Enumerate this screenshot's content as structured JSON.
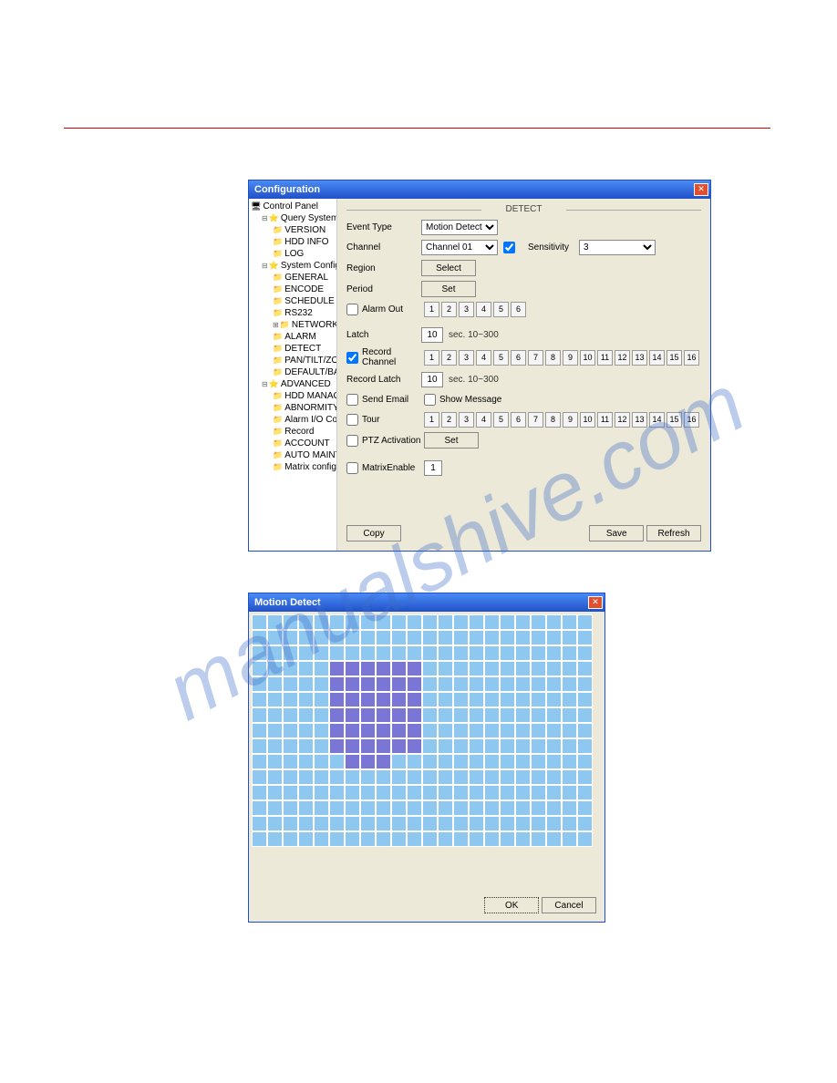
{
  "win1": {
    "title": "Configuration",
    "tree": {
      "root": "Control Panel",
      "groups": [
        {
          "label": "Query System Info",
          "children": [
            "VERSION",
            "HDD INFO",
            "LOG"
          ]
        },
        {
          "label": "System Config",
          "children": [
            "GENERAL",
            "ENCODE",
            "SCHEDULE",
            "RS232",
            "NETWORK",
            "ALARM",
            "DETECT",
            "PAN/TILT/ZOOM",
            "DEFAULT/BACKUP"
          ],
          "selected": "DETECT",
          "expandable": "NETWORK"
        },
        {
          "label": "ADVANCED",
          "children": [
            "HDD MANAGEMENT",
            "ABNORMITY",
            "Alarm I/O Config",
            "Record",
            "ACCOUNT",
            "AUTO MAINTENANCE",
            "Matrix config"
          ]
        }
      ]
    },
    "section": "DETECT",
    "labels": {
      "eventType": "Event Type",
      "channel": "Channel",
      "sensitivity": "Sensitivity",
      "region": "Region",
      "period": "Period",
      "alarmOut": "Alarm Out",
      "latch": "Latch",
      "recordChannel": "Record Channel",
      "recordLatch": "Record Latch",
      "sendEmail": "Send Email",
      "showMessage": "Show Message",
      "tour": "Tour",
      "ptz": "PTZ Activation",
      "matrix": "MatrixEnable"
    },
    "values": {
      "eventType": "Motion Detect",
      "channel": "Channel 01",
      "sensitivity": "3",
      "latch": "10",
      "recordLatch": "10",
      "matrix": "1",
      "latchHint": "sec.   10~300",
      "recordLatchHint": "sec.   10~300"
    },
    "buttons": {
      "select": "Select",
      "set": "Set",
      "copy": "Copy",
      "save": "Save",
      "refresh": "Refresh"
    },
    "alarmOutChips": [
      "1",
      "2",
      "3",
      "4",
      "5",
      "6"
    ],
    "chips16": [
      "1",
      "2",
      "3",
      "4",
      "5",
      "6",
      "7",
      "8",
      "9",
      "10",
      "11",
      "12",
      "13",
      "14",
      "15",
      "16"
    ]
  },
  "win2": {
    "title": "Motion Detect",
    "ok": "OK",
    "cancel": "Cancel",
    "grid": {
      "cols": 22,
      "rows": 15
    },
    "selected": [
      [
        3,
        5
      ],
      [
        3,
        6
      ],
      [
        3,
        7
      ],
      [
        3,
        8
      ],
      [
        3,
        9
      ],
      [
        3,
        10
      ],
      [
        4,
        5
      ],
      [
        4,
        6
      ],
      [
        4,
        7
      ],
      [
        4,
        8
      ],
      [
        4,
        9
      ],
      [
        4,
        10
      ],
      [
        5,
        5
      ],
      [
        5,
        6
      ],
      [
        5,
        7
      ],
      [
        5,
        8
      ],
      [
        5,
        9
      ],
      [
        5,
        10
      ],
      [
        6,
        5
      ],
      [
        6,
        6
      ],
      [
        6,
        7
      ],
      [
        6,
        8
      ],
      [
        6,
        9
      ],
      [
        6,
        10
      ],
      [
        7,
        5
      ],
      [
        7,
        6
      ],
      [
        7,
        7
      ],
      [
        7,
        8
      ],
      [
        7,
        9
      ],
      [
        7,
        10
      ],
      [
        8,
        5
      ],
      [
        8,
        6
      ],
      [
        8,
        7
      ],
      [
        8,
        8
      ],
      [
        8,
        9
      ],
      [
        8,
        10
      ],
      [
        9,
        6
      ],
      [
        9,
        7
      ],
      [
        9,
        8
      ]
    ]
  }
}
